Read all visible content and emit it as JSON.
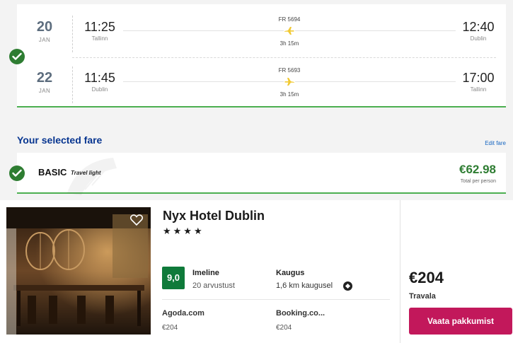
{
  "flights": [
    {
      "day": "20",
      "month": "JAN",
      "dep_time": "11:25",
      "dep_city": "Tallinn",
      "flight_no": "FR 5694",
      "duration": "3h 15m",
      "arr_time": "12:40",
      "arr_city": "Dublin"
    },
    {
      "day": "22",
      "month": "JAN",
      "dep_time": "11:45",
      "dep_city": "Dublin",
      "flight_no": "FR 5693",
      "duration": "3h 15m",
      "arr_time": "17:00",
      "arr_city": "Tallinn"
    }
  ],
  "fare": {
    "heading": "Your selected fare",
    "edit_link": "Edit fare",
    "name": "BASIC",
    "subtitle": "Travel light",
    "price": "€62.98",
    "price_note": "Total per person"
  },
  "hotel": {
    "name": "Nyx Hotel Dublin",
    "stars": "★★★★",
    "rating": "9,0",
    "rating_label": "Imeline",
    "rating_count": "20 arvustust",
    "distance_label": "Kaugus",
    "distance_value": "1,6 km kaugusel",
    "providers": [
      {
        "name": "Agoda.com",
        "price": "€204"
      },
      {
        "name": "Booking.co...",
        "price": "€204"
      }
    ],
    "best_price": "€204",
    "best_provider": "Travala",
    "cta": "Vaata pakkumist"
  },
  "colors": {
    "accent_green": "#2e7d32",
    "heading_blue": "#073590",
    "cta_magenta": "#c2185b",
    "plane_yellow": "#f1c933",
    "rating_green": "#0f7a3a"
  },
  "icons": [
    "check-icon",
    "plane-icon",
    "heart-icon",
    "location-icon"
  ]
}
